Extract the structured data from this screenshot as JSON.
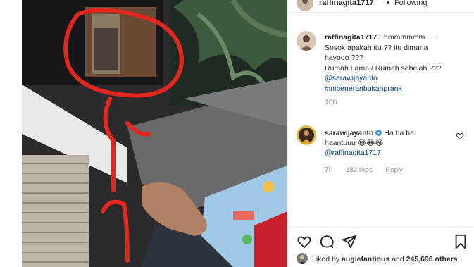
{
  "header": {
    "username": "raffinagita1717",
    "separator": "•",
    "follow_status": "Following"
  },
  "post": {
    "username": "raffinagita1717",
    "lines": [
      "Ehmmmmmm .....",
      "Sosok apakah itu ?? itu dimana",
      "hayooo ???",
      "Rumah Lama / Rumah sebelah ???"
    ],
    "mention": "@sarawijayanto",
    "hashtag": "#inibeneranbukanprank",
    "time": "10h"
  },
  "reply": {
    "username": "sarawijayanto",
    "text_line1": "Ha ha ha",
    "text_line2": "haantuuu 😂😂😂",
    "mention": "@raffinagita1717",
    "age": "7h",
    "likes": "182 likes",
    "reply_label": "Reply"
  },
  "likes": {
    "prefix": "Liked by ",
    "user": "augiefantinus",
    "middle": " and ",
    "count": "245,696 others"
  },
  "icons": [
    "heart-icon",
    "comment-icon",
    "share-icon",
    "bookmark-icon",
    "verified-icon"
  ],
  "colors": {
    "link": "#00376b",
    "verified": "#3897f0",
    "muted": "#8e8e8e",
    "annotation": "#e0281f"
  }
}
